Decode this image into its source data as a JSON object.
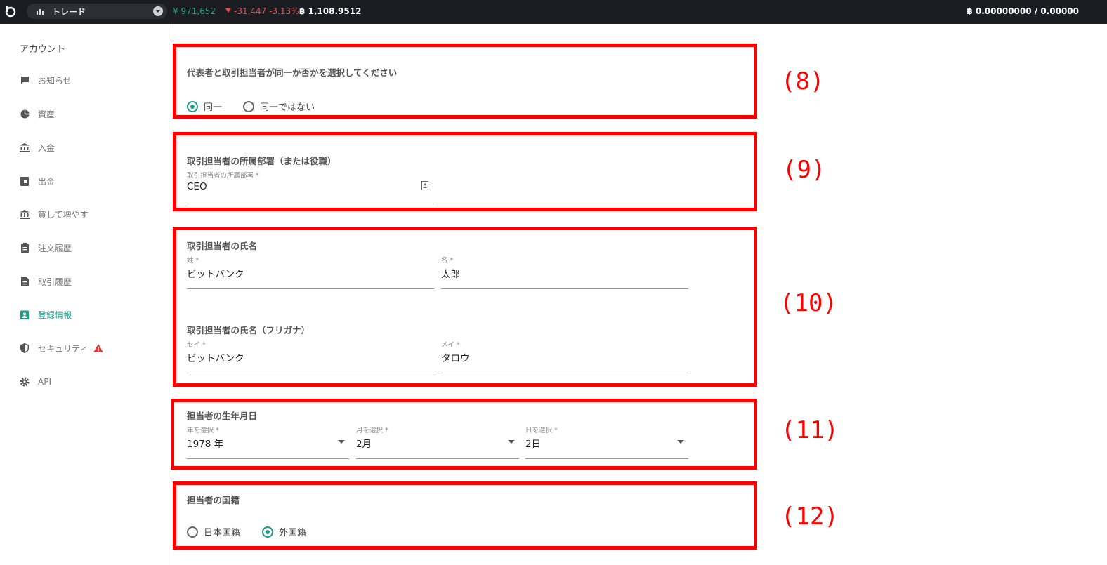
{
  "topbar": {
    "pair_label": "トレード",
    "price_jpy": "¥ 971,652",
    "price_change": "-31,447 -3.13%",
    "price_btc": "฿ 1,108.9512",
    "balance": "฿ 0.00000000 / 0.00000"
  },
  "sidebar": {
    "heading": "アカウント",
    "items": [
      {
        "label": "お知らせ",
        "icon": "message-icon"
      },
      {
        "label": "資産",
        "icon": "pie-chart-icon"
      },
      {
        "label": "入金",
        "icon": "bank-icon"
      },
      {
        "label": "出金",
        "icon": "wallet-icon"
      },
      {
        "label": "貸して増やす",
        "icon": "bank-icon"
      },
      {
        "label": "注文履歴",
        "icon": "clipboard-icon"
      },
      {
        "label": "取引履歴",
        "icon": "document-icon"
      },
      {
        "label": "登録情報",
        "icon": "contact-icon"
      },
      {
        "label": "セキュリティ",
        "icon": "shield-icon"
      },
      {
        "label": "API",
        "icon": "gear-icon"
      }
    ]
  },
  "sections": {
    "s8": {
      "title": "代表者と取引担当者が同一か否かを選択してください",
      "options": [
        "同一",
        "同一ではない"
      ],
      "selected": "同一",
      "marker": "(8)"
    },
    "s9": {
      "title": "取引担当者の所属部署（または役職）",
      "field_label": "取引担当者の所属部署 *",
      "field_value": "CEO",
      "marker": "(9)"
    },
    "s10": {
      "title": "取引担当者の氏名",
      "last_label": "姓 *",
      "last_value": "ビットバンク",
      "first_label": "名 *",
      "first_value": "太郎",
      "kana_title": "取引担当者の氏名（フリガナ）",
      "last_kana_label": "セイ *",
      "last_kana_value": "ビットバンク",
      "first_kana_label": "メイ *",
      "first_kana_value": "タロウ",
      "marker": "(10)"
    },
    "s11": {
      "title": "担当者の生年月日",
      "year_label": "年を選択 *",
      "year_value": "1978 年",
      "month_label": "月を選択 *",
      "month_value": "2月",
      "day_label": "日を選択 *",
      "day_value": "2日",
      "marker": "(11)"
    },
    "s12": {
      "title": "担当者の国籍",
      "options": [
        "日本国籍",
        "外国籍"
      ],
      "selected": "外国籍",
      "marker": "(12)"
    }
  },
  "colors": {
    "accent": "#1e9b85",
    "annotation_red": "#ff0000",
    "down_red": "#ea4d4d",
    "topbar_bg": "#1b1d22"
  }
}
